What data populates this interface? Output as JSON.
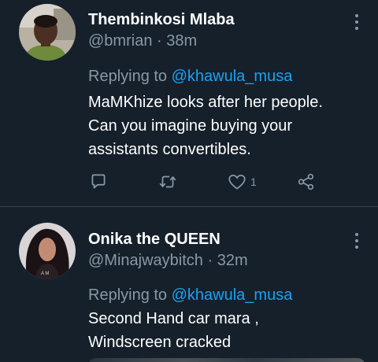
{
  "tweets": [
    {
      "author": {
        "name": "Thembinkosi Mlaba",
        "handle": "@bmrian",
        "time": "38m",
        "avatar_icon": "user-avatar-photo"
      },
      "replying": {
        "prefix": "Replying to",
        "mention": "@khawula_musa"
      },
      "text_lines": [
        "MaMKhize looks after her people.",
        "Can you imagine buying your",
        "assistants convertibles."
      ],
      "actions": {
        "reply_icon": "comment-icon",
        "retweet_icon": "retweet-icon",
        "like_icon": "heart-icon",
        "like_count": "1",
        "share_icon": "share-icon"
      }
    },
    {
      "author": {
        "name": "Onika the QUEEN",
        "handle": "@Minajwaybitch",
        "time": "32m",
        "avatar_icon": "user-avatar-photo"
      },
      "replying": {
        "prefix": "Replying to",
        "mention": "@khawula_musa"
      },
      "text_lines": [
        "Second Hand car mara ,",
        "Windscreen cracked"
      ]
    }
  ],
  "separator": " · ",
  "colors": {
    "background": "#15202b",
    "primary_text": "#ffffff",
    "secondary_text": "#8899a6",
    "accent": "#1da1f2",
    "divider": "#38444d"
  }
}
